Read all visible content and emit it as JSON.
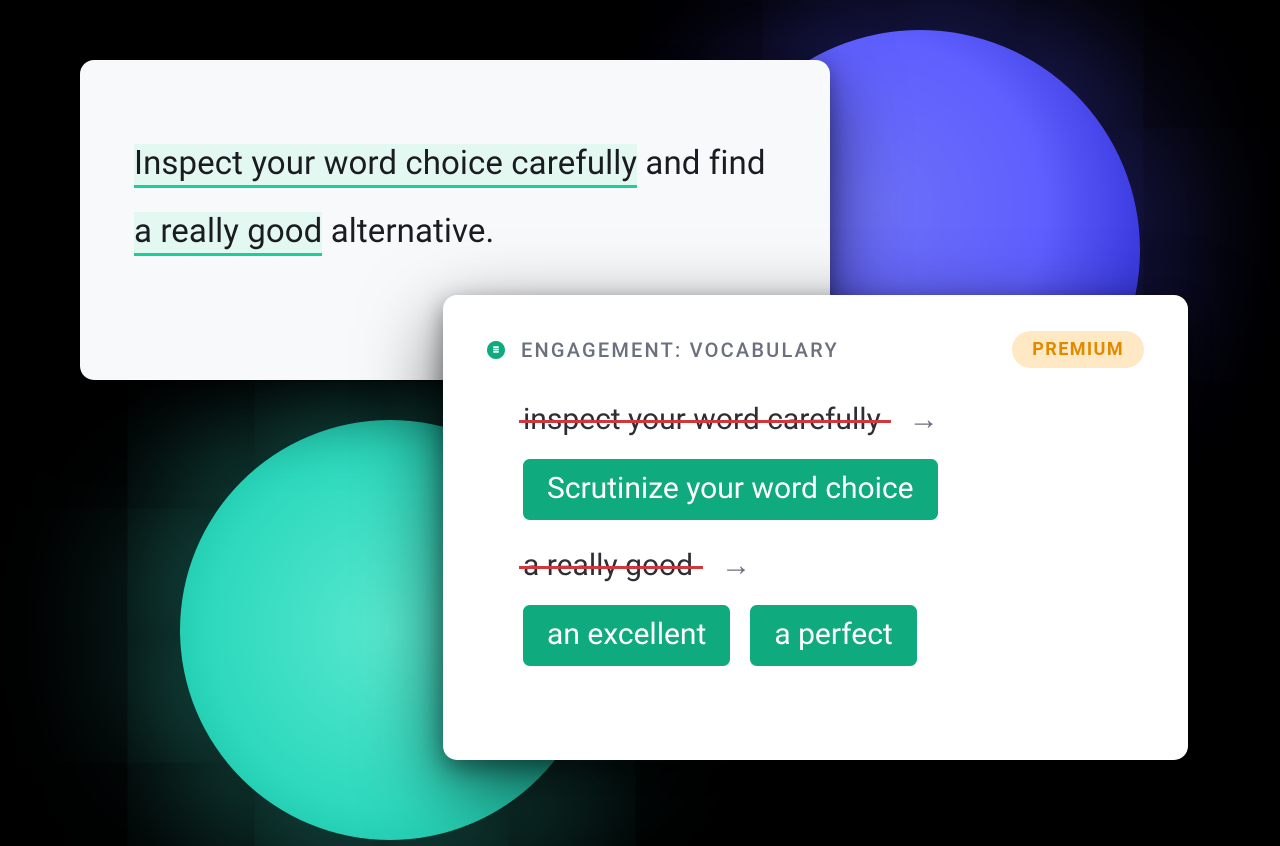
{
  "colors": {
    "green": "#0faa7d",
    "green_underline": "#1bcf9c",
    "green_highlight": "#e4f8f2",
    "badge_bg": "#ffe9c4",
    "badge_text": "#e08a00",
    "strike": "#d1383d"
  },
  "editor": {
    "segments": {
      "hl1": "Inspect your word choice carefully",
      "t1": " and find ",
      "hl2": "a really good",
      "t2": " alternative."
    }
  },
  "panel": {
    "icon": "engagement-dot-icon",
    "category_label": "ENGAGEMENT: VOCABULARY",
    "badge_label": "PREMIUM",
    "suggestions": [
      {
        "original": "inspect your word carefully",
        "arrow": "→",
        "replacements": [
          "Scrutinize your word choice"
        ]
      },
      {
        "original": "a really good",
        "arrow": "→",
        "replacements": [
          "an excellent",
          "a perfect"
        ]
      }
    ]
  }
}
